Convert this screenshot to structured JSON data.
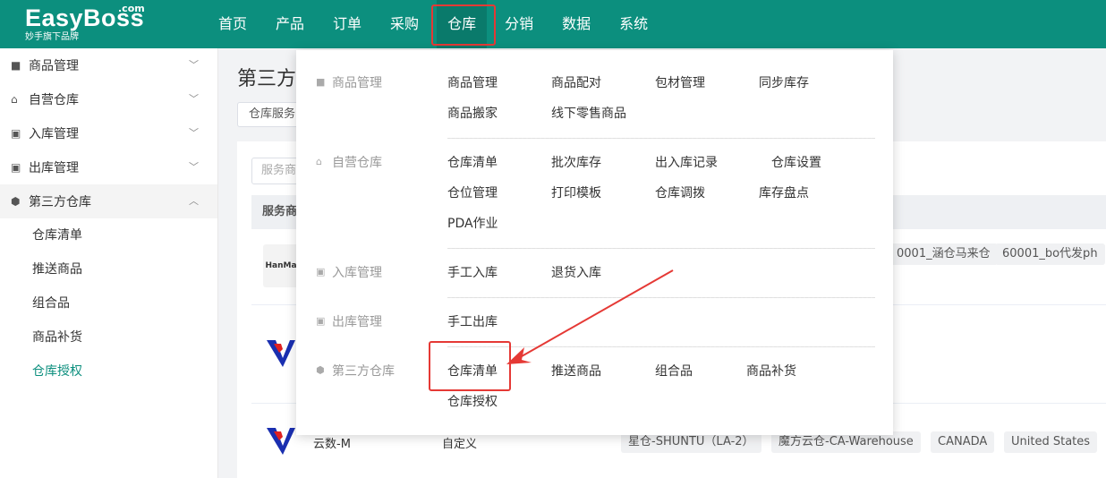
{
  "brand": {
    "name": "EasyBoss",
    "domain_suffix": ".com",
    "tagline": "妙手旗下品牌"
  },
  "nav": [
    "首页",
    "产品",
    "订单",
    "采购",
    "仓库",
    "分销",
    "数据",
    "系统"
  ],
  "sidebar": {
    "groups": [
      {
        "label": "商品管理",
        "icon": "box-icon",
        "expanded": false
      },
      {
        "label": "自营仓库",
        "icon": "home-icon",
        "expanded": false
      },
      {
        "label": "入库管理",
        "icon": "inbound-icon",
        "expanded": false
      },
      {
        "label": "出库管理",
        "icon": "outbound-icon",
        "expanded": false
      },
      {
        "label": "第三方仓库",
        "icon": "shield-icon",
        "expanded": true
      }
    ],
    "sub_items": [
      "仓库清单",
      "推送商品",
      "组合品",
      "商品补货",
      "仓库授权"
    ],
    "active_sub": "仓库授权"
  },
  "main": {
    "title": "第三方",
    "filter_chip": "仓库服务",
    "search_placeholder": "服务商",
    "table_header": "服务商",
    "row1": {
      "logo_text": "HanMa",
      "tags": [
        "0001_涵仓马来仓",
        "60001_bo代发ph"
      ]
    },
    "row3": {
      "name": "云数-M",
      "type": "自定义",
      "tags": [
        "星仓-SHUNTU（LA-2）",
        "魔方云仓-CA-Warehouse",
        "CANADA",
        "United States"
      ]
    }
  },
  "menu": {
    "sections": [
      {
        "category": "商品管理",
        "links": [
          [
            "商品管理",
            "商品配对",
            "包材管理",
            "同步库存"
          ],
          [
            "商品搬家",
            "线下零售商品"
          ]
        ]
      },
      {
        "category": "自营仓库",
        "links": [
          [
            "仓库清单",
            "批次库存",
            "出入库记录",
            "仓库设置"
          ],
          [
            "仓位管理",
            "打印模板",
            "仓库调拨",
            "库存盘点"
          ],
          [
            "PDA作业"
          ]
        ]
      },
      {
        "category": "入库管理",
        "links": [
          [
            "手工入库",
            "退货入库"
          ]
        ]
      },
      {
        "category": "出库管理",
        "links": [
          [
            "手工出库"
          ]
        ]
      },
      {
        "category": "第三方仓库",
        "links": [
          [
            "仓库清单",
            "推送商品",
            "组合品",
            "商品补货"
          ],
          [
            "仓库授权"
          ]
        ]
      }
    ]
  },
  "colors": {
    "brand_green": "#0c8f7e",
    "highlight_red": "#e53935"
  }
}
